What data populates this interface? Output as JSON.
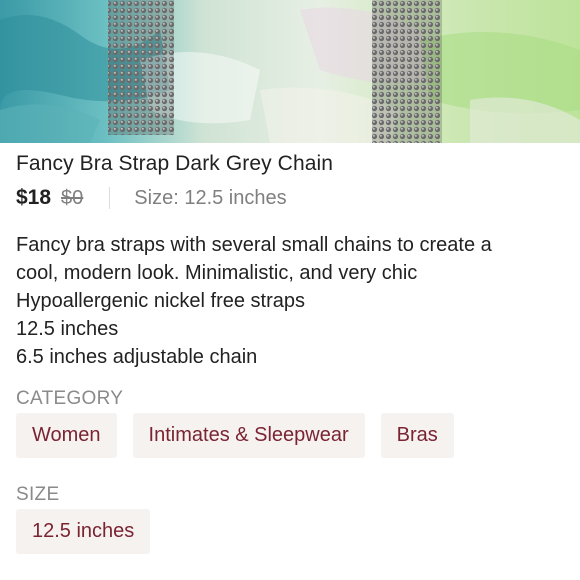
{
  "listing": {
    "title": "Fancy Bra Strap Dark Grey Chain",
    "price": "$18",
    "original_price": "$0",
    "size_label": "Size: 12.5 inches",
    "description_lines": [
      "Fancy bra straps with several small chains to create a",
      "cool, modern look. Minimalistic, and very chic",
      "Hypoallergenic nickel free straps",
      "12.5 inches",
      "6.5 inches adjustable chain"
    ]
  },
  "category": {
    "label": "CATEGORY",
    "chips": [
      "Women",
      "Intimates & Sleepwear",
      "Bras"
    ]
  },
  "size": {
    "label": "SIZE",
    "chips": [
      "12.5 inches"
    ]
  },
  "colors": {
    "text": "#222222",
    "muted": "#7f7f7f",
    "chip_bg": "#f6f2f0",
    "chip_text": "#7a2432"
  }
}
